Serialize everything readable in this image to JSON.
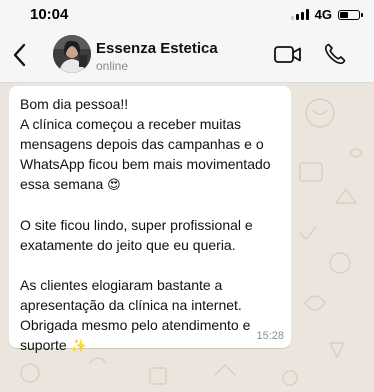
{
  "status_bar": {
    "time": "10:04",
    "network": "4G",
    "battery_level": 0.45
  },
  "header": {
    "contact_name": "Essenza Estetica",
    "contact_status": "online",
    "icons": [
      "back-icon",
      "video-call-icon",
      "phone-call-icon"
    ]
  },
  "message": {
    "paragraphs": [
      {
        "lines": [
          "Bom dia pessoa!!",
          "A clínica começou a receber muitas",
          "mensagens depois das campanhas e o",
          "WhatsApp ficou bem mais movimentado",
          "essa semana"
        ],
        "emoji": "😍"
      },
      {
        "lines": [
          "O site ficou lindo, super profissional e",
          "exatamente do jeito que eu queria."
        ],
        "emoji": ""
      },
      {
        "lines": [
          "As clientes elogiaram bastante a",
          "apresentação da clínica na internet.",
          "Obrigada mesmo pelo atendimento e",
          "suporte"
        ],
        "emoji": "✨"
      }
    ],
    "time": "15:28"
  },
  "colors": {
    "header_bg": "#f6f6f6",
    "chat_bg": "#ece5dd",
    "bubble_bg": "#ffffff",
    "muted_text": "#8a8a8a"
  }
}
